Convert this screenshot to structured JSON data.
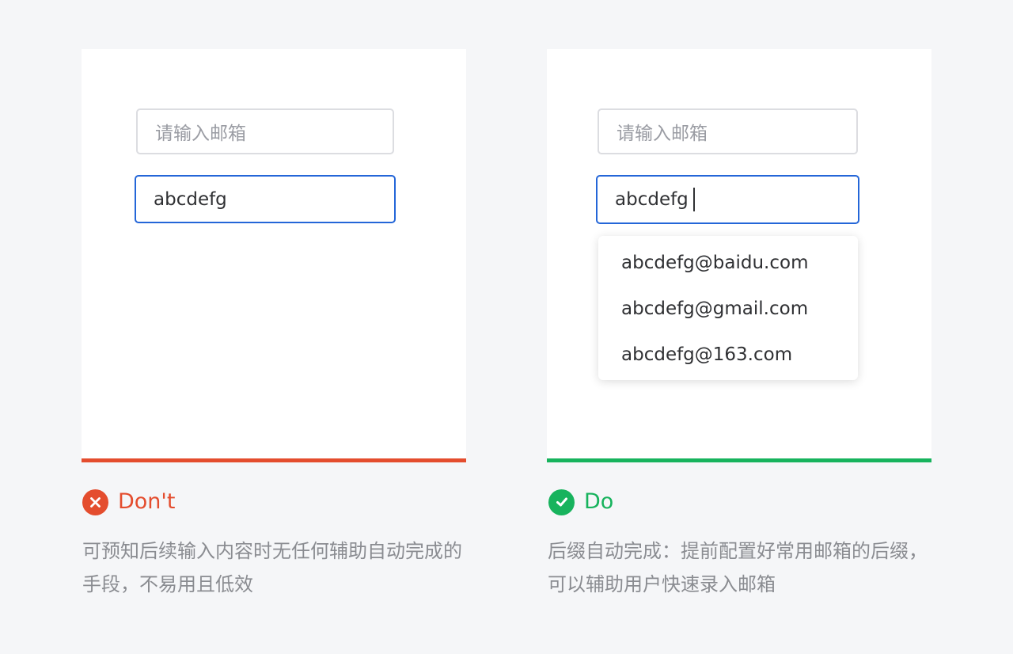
{
  "dont_panel": {
    "input_placeholder": "请输入邮箱",
    "input_value": "abcdefg",
    "status_label": "Don't",
    "status_icon": "close-icon",
    "status_color": "#e44d2e",
    "description": "可预知后续输入内容时无任何辅助自动完成的手段，不易用且低效"
  },
  "do_panel": {
    "input_placeholder": "请输入邮箱",
    "input_value": "abcdefg",
    "suggestions": [
      "abcdefg@baidu.com",
      "abcdefg@gmail.com",
      "abcdefg@163.com"
    ],
    "status_label": "Do",
    "status_icon": "check-icon",
    "status_color": "#17b35d",
    "description": "后缀自动完成：提前配置好常用邮箱的后缀，可以辅助用户快速录入邮箱"
  },
  "colors": {
    "focus_border": "#2466d8",
    "placeholder_text": "#9a9ca3",
    "background": "#f5f6f8"
  }
}
